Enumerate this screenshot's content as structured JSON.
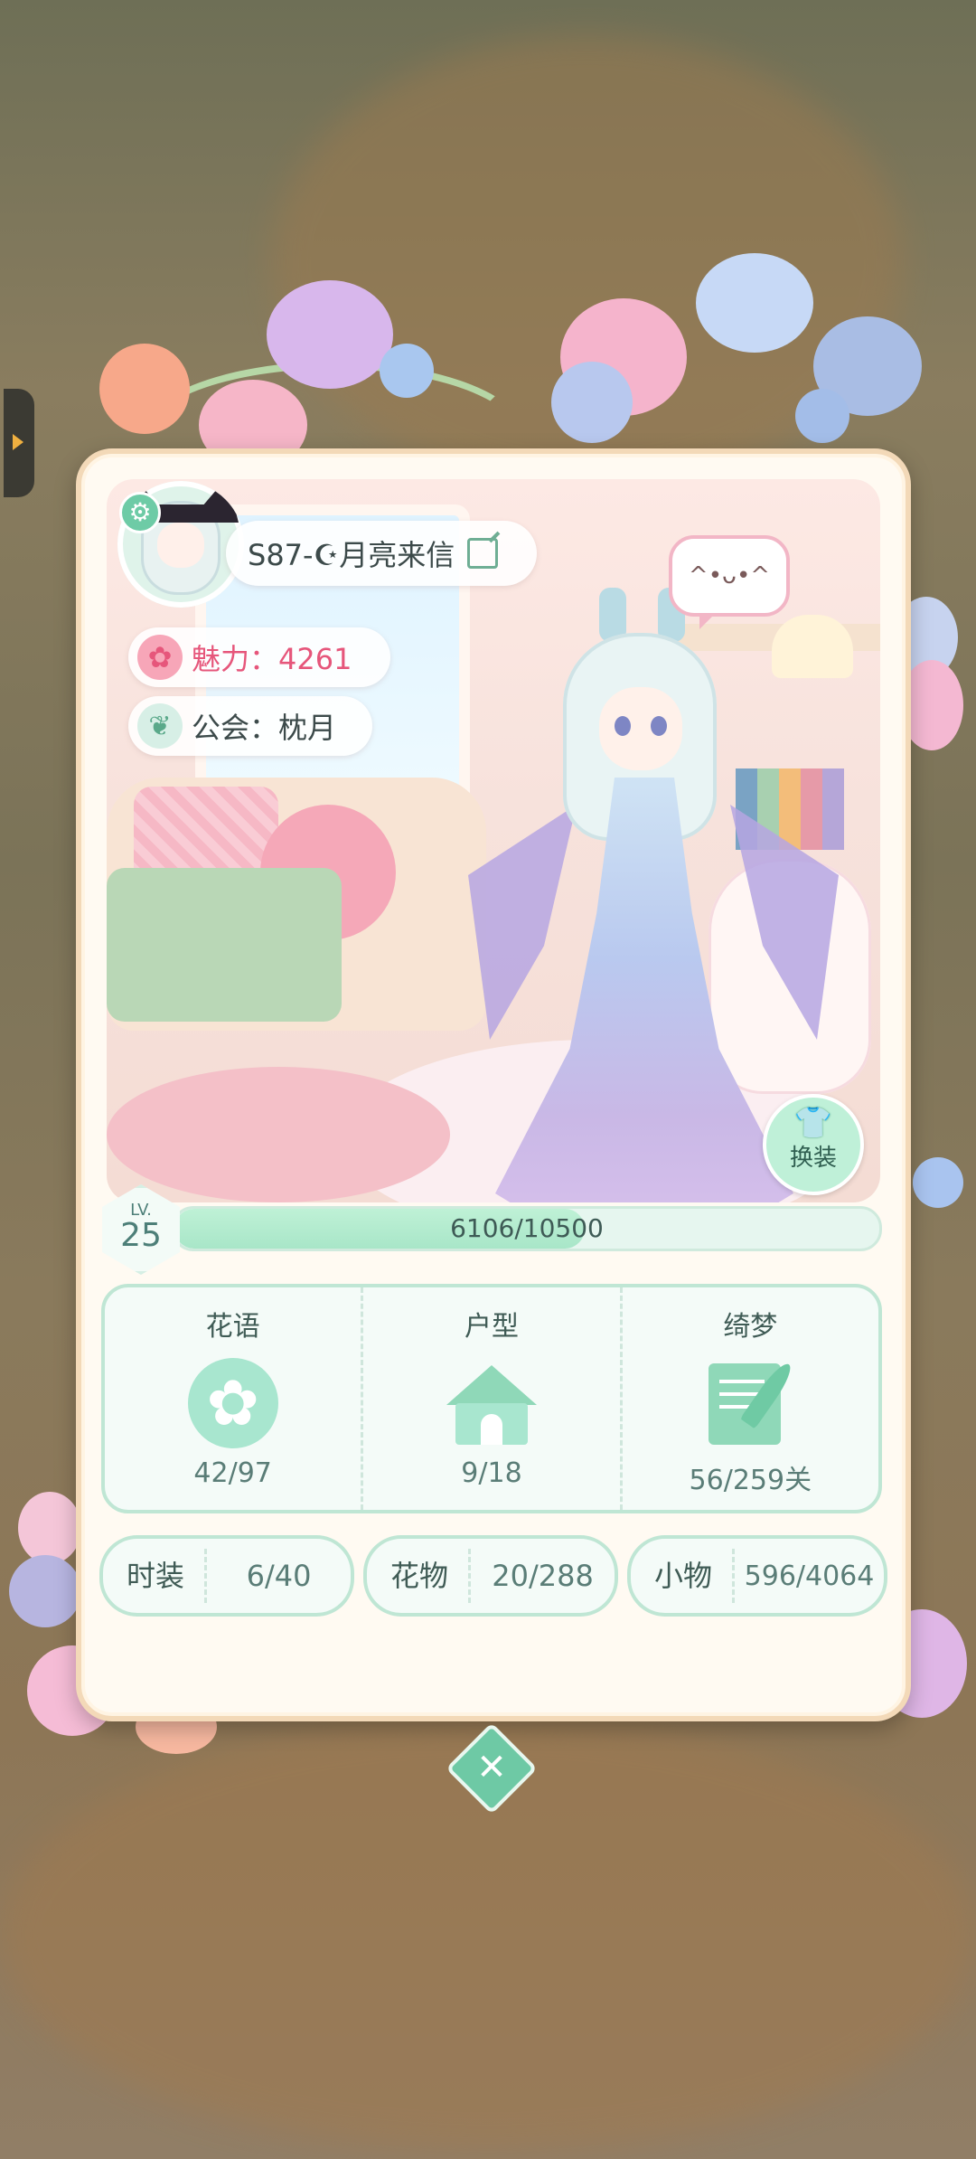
{
  "player": {
    "name": "S87-☪月亮来信",
    "charm_label": "魅力：4261",
    "guild_label": "公会：枕月",
    "emote": "^•ᴗ•^"
  },
  "level": {
    "label": "LV.",
    "value": "25",
    "exp_text": "6106/10500",
    "exp_progress": 0.5815
  },
  "actions": {
    "change_outfit": "换装",
    "close_symbol": "✕"
  },
  "stats": [
    {
      "title": "花语",
      "value": "42/97",
      "icon": "flower-icon"
    },
    {
      "title": "户型",
      "value": "9/18",
      "icon": "house-icon"
    },
    {
      "title": "绮梦",
      "value": "56/259关",
      "icon": "letter-quill-icon"
    }
  ],
  "collections": [
    {
      "title": "时装",
      "value": "6/40"
    },
    {
      "title": "花物",
      "value": "20/288"
    },
    {
      "title": "小物",
      "value": "596/4064"
    }
  ],
  "colors": {
    "accent_green": "#6ec9a5",
    "charm_pink": "#e6567b",
    "card_border": "#f3d9b8"
  }
}
